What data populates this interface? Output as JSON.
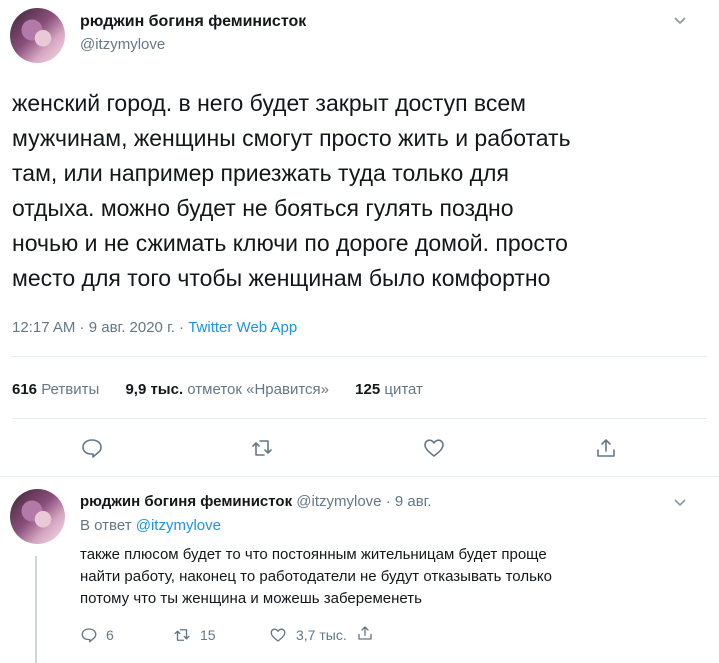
{
  "tweet": {
    "author_name": "рюджин богиня феминисток",
    "author_handle": "@itzymylove",
    "text_lines": [
      "женский город. в него будет закрыт доступ всем",
      "мужчинам, женщины смогут просто жить и работать",
      "там, или например приезжать туда только для",
      "отдыха. можно будет не бояться гулять поздно",
      "ночью и не сжимать ключи по дороге домой. просто",
      "место для того чтобы женщинам было комфортно"
    ],
    "time": "12:17 AM",
    "date": "9 авг. 2020 г.",
    "sep": " · ",
    "source": "Twitter Web App",
    "retweets_count": "616",
    "retweets_label": "Ретвиты",
    "likes_count": "9,9 тыс.",
    "likes_label": "отметок «Нравится»",
    "quotes_count": "125",
    "quotes_label": "цитат"
  },
  "reply": {
    "author_name": "рюджин богиня феминисток",
    "author_handle": "@itzymylove",
    "date": "· 9 авг.",
    "reply_to_label": "В ответ",
    "reply_to_handle": "@itzymylove",
    "text_lines": [
      "также плюсом будет то что постоянным жительницам будет проще",
      "найти работу, наконец то работодатели не будут отказывать только",
      "потому что ты женщина и можешь забеременеть"
    ],
    "reply_count": "6",
    "retweet_count": "15",
    "like_count": "3,7 тыс."
  },
  "colors": {
    "text": "#14171a",
    "secondary": "#657786",
    "link": "#1b95e0",
    "border": "#e6ecf0",
    "icon": "#657786"
  },
  "icons": [
    "reply-icon",
    "retweet-icon",
    "like-icon",
    "share-icon",
    "chevron-down-icon"
  ]
}
